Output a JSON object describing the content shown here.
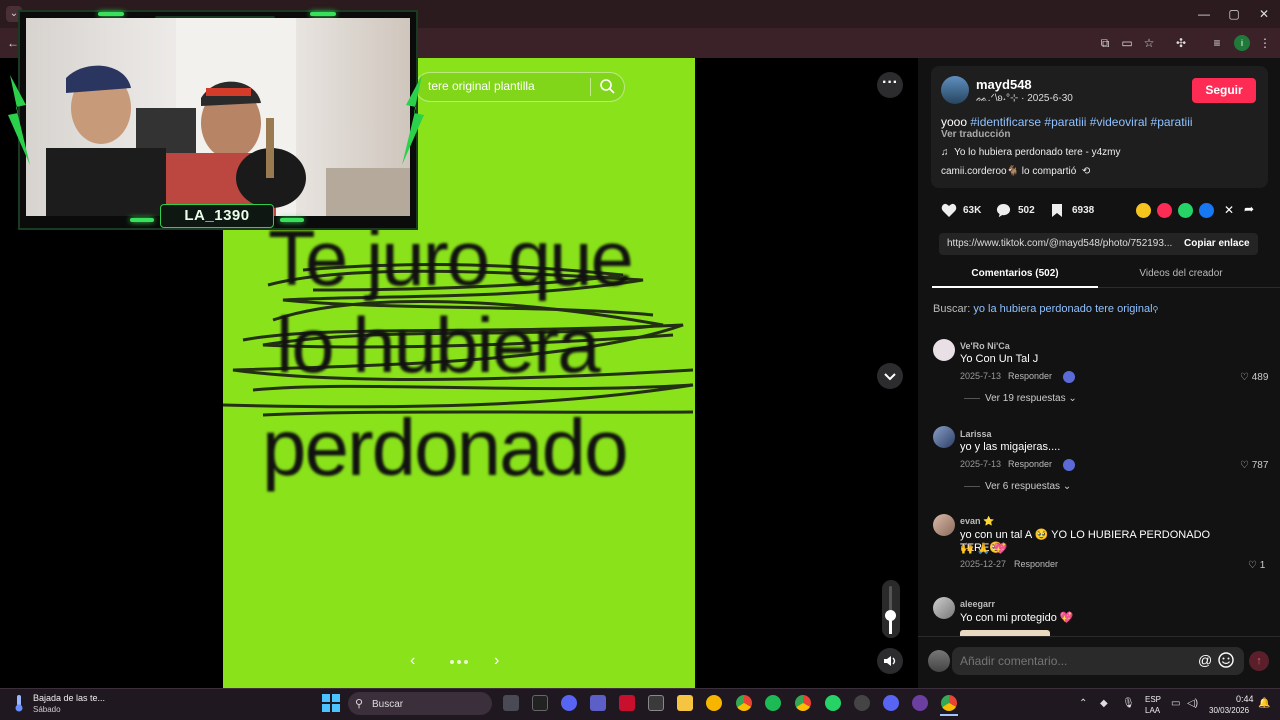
{
  "browser": {
    "window_controls": [
      "—",
      "▢",
      "✕"
    ]
  },
  "search": {
    "query": "tere original plantilla"
  },
  "video": {
    "lines": [
      "Te juro que",
      "lo hubiera",
      "perdonado"
    ],
    "bg_color": "#8ae21b"
  },
  "webcam": {
    "tag": "LA_1390"
  },
  "post": {
    "username": "mayd548",
    "subline": "ᨐ.ᐟ\\ʚ˖°⊹ · 2025-6-30",
    "follow_label": "Seguir",
    "caption_text": "yooo ",
    "hashtags": [
      "#identificarse",
      "#paratiii",
      "#videoviral",
      "#paratiii"
    ],
    "translate": "Ver traducción",
    "music": "Yo lo hubiera perdonado tere - y4zmy",
    "shared_by": "camii.corderoo🐐 lo compartió",
    "likes": "63K",
    "comments": "502",
    "saves": "6938",
    "link": "https://www.tiktok.com/@mayd548/photo/752193...",
    "copy_label": "Copiar enlace"
  },
  "tabs": {
    "comments": "Comentarios (502)",
    "videos": "Videos del creador"
  },
  "search_hint": {
    "prefix": "Buscar: ",
    "query": "yo la hubiera perdonado tere original"
  },
  "comments": [
    {
      "user": "Ve'Ro Ni'Ca",
      "text": "Yo Con Un Tal J",
      "date": "2025-7-13",
      "reply": "Responder",
      "likes": "489",
      "more": "Ver 19 respuestas"
    },
    {
      "user": "Larissa",
      "text": "yo y las migajeras....",
      "date": "2025-7-13",
      "reply": "Responder",
      "likes": "787",
      "more": "Ver 6 respuestas"
    },
    {
      "user": "evan ⭐",
      "text": "yo con un tal A 🥹 YO LO HUBIERA PERDONADO TERE🥺",
      "text2": "🙌 🙏 💖",
      "date": "2025-12-27",
      "reply": "Responder",
      "likes": "1"
    },
    {
      "user": "aleegarr",
      "text": "Yo con mi protegido 💖"
    }
  ],
  "comment_input": {
    "placeholder": "Añadir comentario..."
  },
  "taskbar": {
    "weather_title": "Bajada de las te...",
    "weather_sub": "Sábado",
    "search_label": "Buscar",
    "lang1": "ESP",
    "lang2": "LAA",
    "time": "0:44",
    "date": "30/03/2026"
  }
}
